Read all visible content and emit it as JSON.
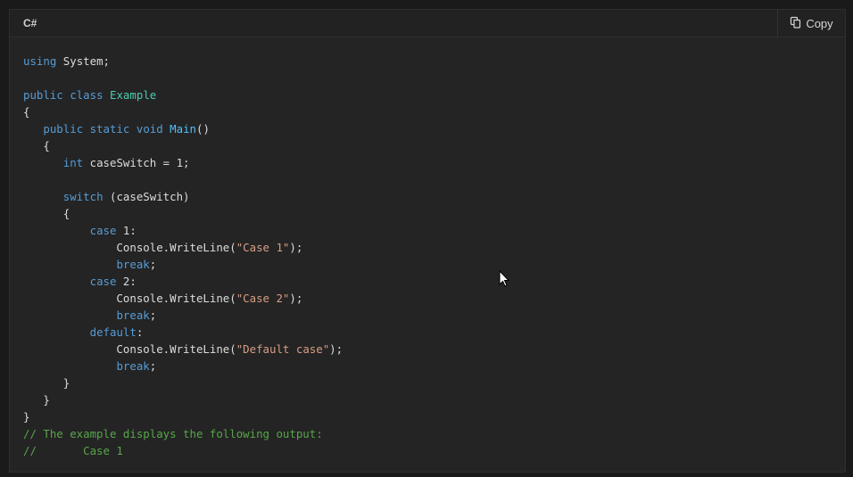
{
  "header": {
    "language": "C#",
    "copy_label": "Copy",
    "copy_icon": "copy-icon"
  },
  "code": {
    "lines": [
      [
        {
          "t": "using",
          "c": "kw"
        },
        {
          "t": " System;",
          "c": ""
        }
      ],
      [],
      [
        {
          "t": "public",
          "c": "kw"
        },
        {
          "t": " ",
          "c": ""
        },
        {
          "t": "class",
          "c": "kw"
        },
        {
          "t": " ",
          "c": ""
        },
        {
          "t": "Example",
          "c": "ty"
        }
      ],
      [
        {
          "t": "{",
          "c": ""
        }
      ],
      [
        {
          "t": "   ",
          "c": ""
        },
        {
          "t": "public",
          "c": "kw"
        },
        {
          "t": " ",
          "c": ""
        },
        {
          "t": "static",
          "c": "kw"
        },
        {
          "t": " ",
          "c": ""
        },
        {
          "t": "void",
          "c": "kw"
        },
        {
          "t": " ",
          "c": ""
        },
        {
          "t": "Main",
          "c": "fn"
        },
        {
          "t": "()",
          "c": ""
        }
      ],
      [
        {
          "t": "   {",
          "c": ""
        }
      ],
      [
        {
          "t": "      ",
          "c": ""
        },
        {
          "t": "int",
          "c": "kw"
        },
        {
          "t": " caseSwitch = 1;",
          "c": ""
        }
      ],
      [],
      [
        {
          "t": "      ",
          "c": ""
        },
        {
          "t": "switch",
          "c": "kw"
        },
        {
          "t": " (caseSwitch)",
          "c": ""
        }
      ],
      [
        {
          "t": "      {",
          "c": ""
        }
      ],
      [
        {
          "t": "          ",
          "c": ""
        },
        {
          "t": "case",
          "c": "kw"
        },
        {
          "t": " 1:",
          "c": ""
        }
      ],
      [
        {
          "t": "              Console.WriteLine(",
          "c": ""
        },
        {
          "t": "\"Case 1\"",
          "c": "str"
        },
        {
          "t": ");",
          "c": ""
        }
      ],
      [
        {
          "t": "              ",
          "c": ""
        },
        {
          "t": "break",
          "c": "kw"
        },
        {
          "t": ";",
          "c": ""
        }
      ],
      [
        {
          "t": "          ",
          "c": ""
        },
        {
          "t": "case",
          "c": "kw"
        },
        {
          "t": " 2:",
          "c": ""
        }
      ],
      [
        {
          "t": "              Console.WriteLine(",
          "c": ""
        },
        {
          "t": "\"Case 2\"",
          "c": "str"
        },
        {
          "t": ");",
          "c": ""
        }
      ],
      [
        {
          "t": "              ",
          "c": ""
        },
        {
          "t": "break",
          "c": "kw"
        },
        {
          "t": ";",
          "c": ""
        }
      ],
      [
        {
          "t": "          ",
          "c": ""
        },
        {
          "t": "default",
          "c": "kw"
        },
        {
          "t": ":",
          "c": ""
        }
      ],
      [
        {
          "t": "              Console.WriteLine(",
          "c": ""
        },
        {
          "t": "\"Default case\"",
          "c": "str"
        },
        {
          "t": ");",
          "c": ""
        }
      ],
      [
        {
          "t": "              ",
          "c": ""
        },
        {
          "t": "break",
          "c": "kw"
        },
        {
          "t": ";",
          "c": ""
        }
      ],
      [
        {
          "t": "      }",
          "c": ""
        }
      ],
      [
        {
          "t": "   }",
          "c": ""
        }
      ],
      [
        {
          "t": "}",
          "c": ""
        }
      ],
      [
        {
          "t": "// The example displays the following output:",
          "c": "cm"
        }
      ],
      [
        {
          "t": "//       Case 1",
          "c": "cm"
        }
      ]
    ]
  },
  "colors": {
    "keyword": "#569cd6",
    "type": "#4ec9b0",
    "string": "#d69d85",
    "comment": "#57a64a",
    "text": "#dcdcdc",
    "background": "#242424"
  }
}
